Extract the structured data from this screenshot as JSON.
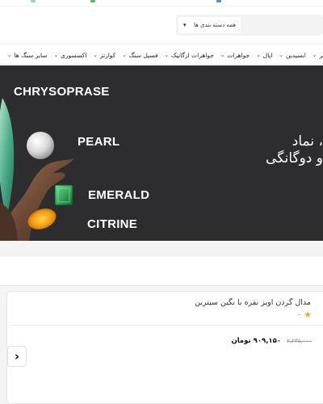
{
  "header": {
    "search": {
      "category_select": "همه دسته بندی ها",
      "chevron_icon": "chevron-down-icon"
    }
  },
  "nav": {
    "items": [
      {
        "label": "سیر",
        "icon": "chevron-down-icon"
      },
      {
        "label": "ابسیدین",
        "icon": "chevron-down-icon"
      },
      {
        "label": "اپال",
        "icon": "chevron-down-icon"
      },
      {
        "label": "جواهرات",
        "icon": "chevron-down-icon"
      },
      {
        "label": "جواهرات ارگانیک",
        "icon": "chevron-down-icon"
      },
      {
        "label": "فسیل سنگ",
        "icon": "chevron-down-icon"
      },
      {
        "label": "کوارتز",
        "icon": "chevron-down-icon"
      },
      {
        "label": "اکسسوری",
        "icon": "chevron-down-icon"
      },
      {
        "label": "سایر سنگ ها",
        "icon": "chevron-down-icon"
      }
    ]
  },
  "banner": {
    "gems": {
      "chrysoprase": "CHRYSOPRASE",
      "pearl": "PEARL",
      "emerald": "EMERALD",
      "citrine": "CITRINE"
    },
    "headline_line1": "، نماد",
    "headline_line2": "و دوگانگی",
    "background": "#2d2d2f"
  },
  "product": {
    "title": "مدال گردن اویز نقره با نگین سیترین",
    "rating_count": "۰",
    "star_icon": "star-icon",
    "price": "۹۰۹,۱۵۰ تومان",
    "old_price": "۲,۲۳۵,۰۰۰",
    "accent": "#f5a623"
  },
  "carousel": {
    "next_icon": "chevron-right-icon",
    "next_glyph": "›"
  }
}
